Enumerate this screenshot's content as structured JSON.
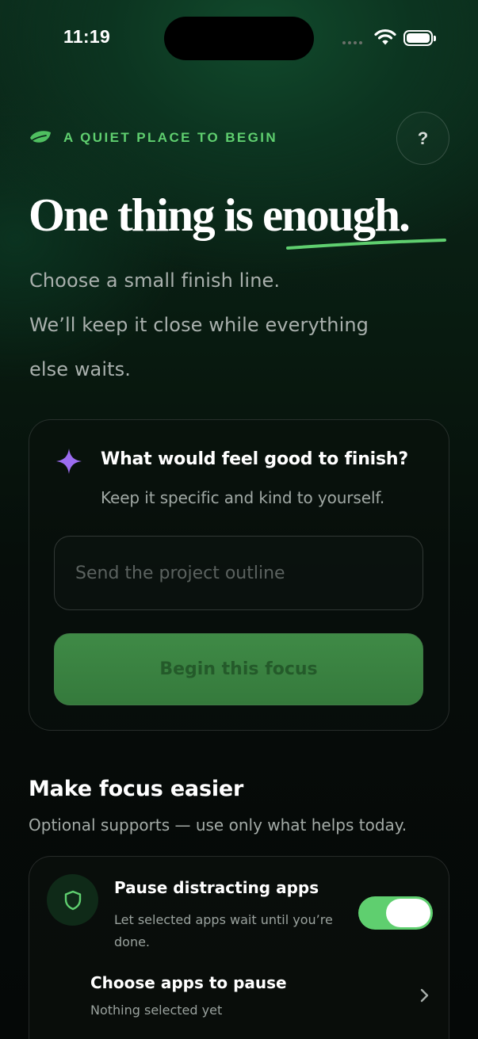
{
  "status_bar": {
    "time": "11:19",
    "icons": [
      "cellular-signal-icon",
      "wifi-icon",
      "battery-icon"
    ]
  },
  "header": {
    "tagline": "A QUIET PLACE TO BEGIN",
    "tagline_icon": "leaf-icon",
    "help_label": "?",
    "headline": "One thing is enough.",
    "intro_lines": [
      "Choose a small finish line.",
      "We’ll keep it close while everything",
      "else waits."
    ]
  },
  "focus_card": {
    "icon": "sparkle-icon",
    "title": "What would feel good to finish?",
    "subtitle": "Keep it specific and kind to yourself.",
    "input": {
      "value": "",
      "placeholder": "Send the project outline"
    },
    "begin_label": "Begin this focus"
  },
  "supports": {
    "title": "Make focus easier",
    "subtitle": "Optional supports — use only what helps today.",
    "pause_apps": {
      "icon": "shield-icon",
      "title": "Pause distracting apps",
      "description": "Let selected apps wait until you’re done.",
      "enabled": true
    },
    "choose_apps": {
      "title": "Choose apps to pause",
      "subtitle": "Nothing selected yet"
    }
  },
  "colors": {
    "accent": "#5fcf6f",
    "sparkle": "#9b6cf0",
    "background": "#050807"
  }
}
